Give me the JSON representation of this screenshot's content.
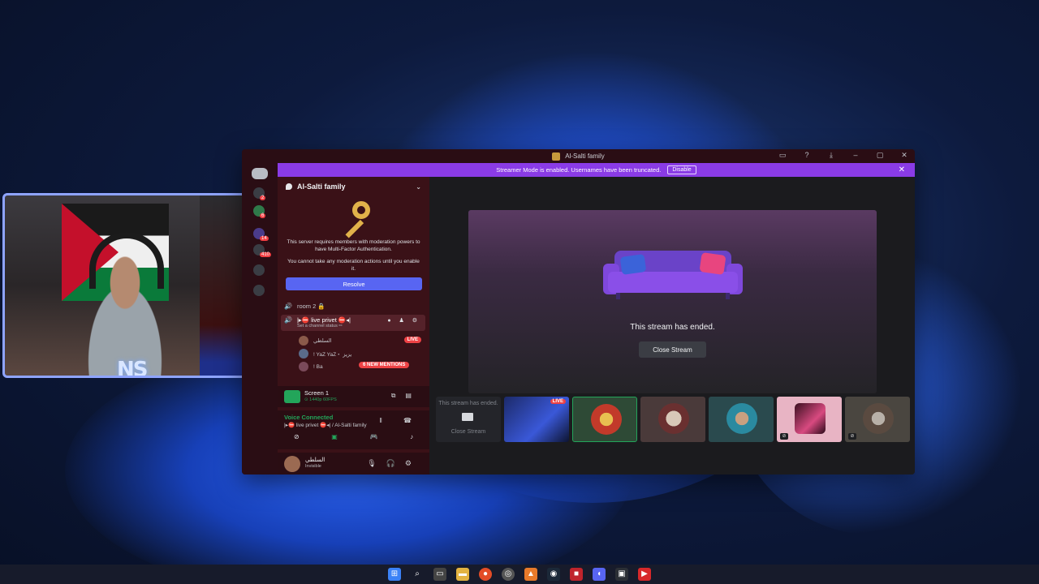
{
  "window": {
    "title": "Al-Salti family",
    "controls": [
      "inbox-icon",
      "help-icon",
      "download-icon",
      "minimize-icon",
      "maximize-icon",
      "close-icon"
    ]
  },
  "banner": {
    "text": "Streamer Mode is enabled. Usernames have been truncated.",
    "disable_label": "Disable"
  },
  "rail": {
    "badges": [
      "2",
      "6",
      "14",
      "410"
    ]
  },
  "sidebar": {
    "server_name": "Al-Salti family",
    "mfa": {
      "line1": "This server requires members with moderation powers to have Multi-Factor Authentication.",
      "line2": "You cannot take any moderation actions until you enable it.",
      "resolve_label": "Resolve"
    },
    "channels": [
      {
        "name": "room 2 🔒"
      },
      {
        "name": "|▸⛔ live privet ⛔◂|",
        "status": "Set a channel status ✏"
      }
    ],
    "members": [
      {
        "name": "السلطي",
        "badge": "LIVE"
      },
      {
        "name": "! YaZ YaZ・ يزيز"
      },
      {
        "name": "! Ba",
        "badge": "6 NEW MENTIONS"
      }
    ],
    "screen": {
      "title": "Screen 1",
      "sub": "⊙ 1440p 60FPS"
    },
    "voice": {
      "status": "Voice Connected",
      "channel": "|▸⛔ live privet ⛔◂| / Al-Salti family"
    },
    "user": {
      "name": "السلطي",
      "status": "Invisible"
    }
  },
  "stage": {
    "ended_text": "This stream has ended.",
    "close_label": "Close Stream"
  },
  "thumbs": {
    "first_title": "This stream has ended.",
    "first_button": "Close Stream",
    "live_badge": "LIVE"
  },
  "webcam": {
    "logo": "NS"
  }
}
